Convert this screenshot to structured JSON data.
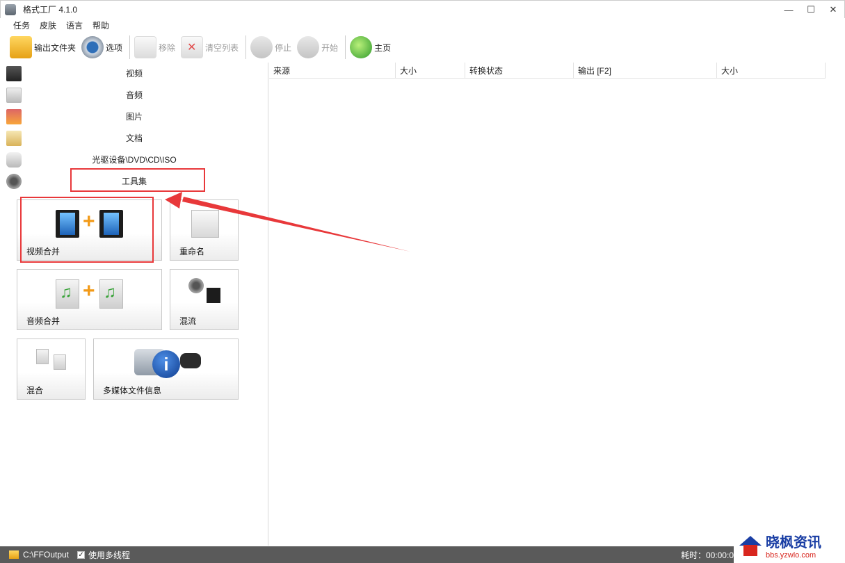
{
  "window": {
    "title": "格式工厂 4.1.0",
    "controls": {
      "minimize": "—",
      "maximize": "☐",
      "close": "✕"
    }
  },
  "menu": {
    "items": [
      "任务",
      "皮肤",
      "语言",
      "帮助"
    ]
  },
  "toolbar": {
    "output_folder": "输出文件夹",
    "options": "选项",
    "remove": "移除",
    "clear_list": "清空列表",
    "stop": "停止",
    "start": "开始",
    "home": "主页"
  },
  "sidebar": {
    "categories": [
      {
        "label": "视频",
        "icon": "video-icon"
      },
      {
        "label": "音频",
        "icon": "audio-icon"
      },
      {
        "label": "图片",
        "icon": "image-icon"
      },
      {
        "label": "文档",
        "icon": "document-icon"
      },
      {
        "label": "光驱设备\\DVD\\CD\\ISO",
        "icon": "disc-icon"
      },
      {
        "label": "工具集",
        "icon": "tools-icon"
      }
    ],
    "tools": [
      {
        "label": "视频合并",
        "icon": "video-join-icon"
      },
      {
        "label": "重命名",
        "icon": "rename-icon"
      },
      {
        "label": "音频合并",
        "icon": "audio-join-icon"
      },
      {
        "label": "混流",
        "icon": "mux-icon"
      },
      {
        "label": "混合",
        "icon": "mix-icon"
      },
      {
        "label": "多媒体文件信息",
        "icon": "media-info-icon"
      }
    ]
  },
  "task_table": {
    "columns": [
      "来源",
      "大小",
      "转换状态",
      "输出 [F2]",
      "大小"
    ]
  },
  "status_bar": {
    "output_path": "C:\\FFOutput",
    "multithread_label": "使用多线程",
    "multithread_checked": true,
    "elapsed": "耗时：00:00:0"
  },
  "watermark": {
    "title": "晓枫资讯",
    "url": "bbs.yzwlo.com"
  },
  "colors": {
    "highlight": "#e8383a",
    "status_bg": "#5a5a5a"
  }
}
